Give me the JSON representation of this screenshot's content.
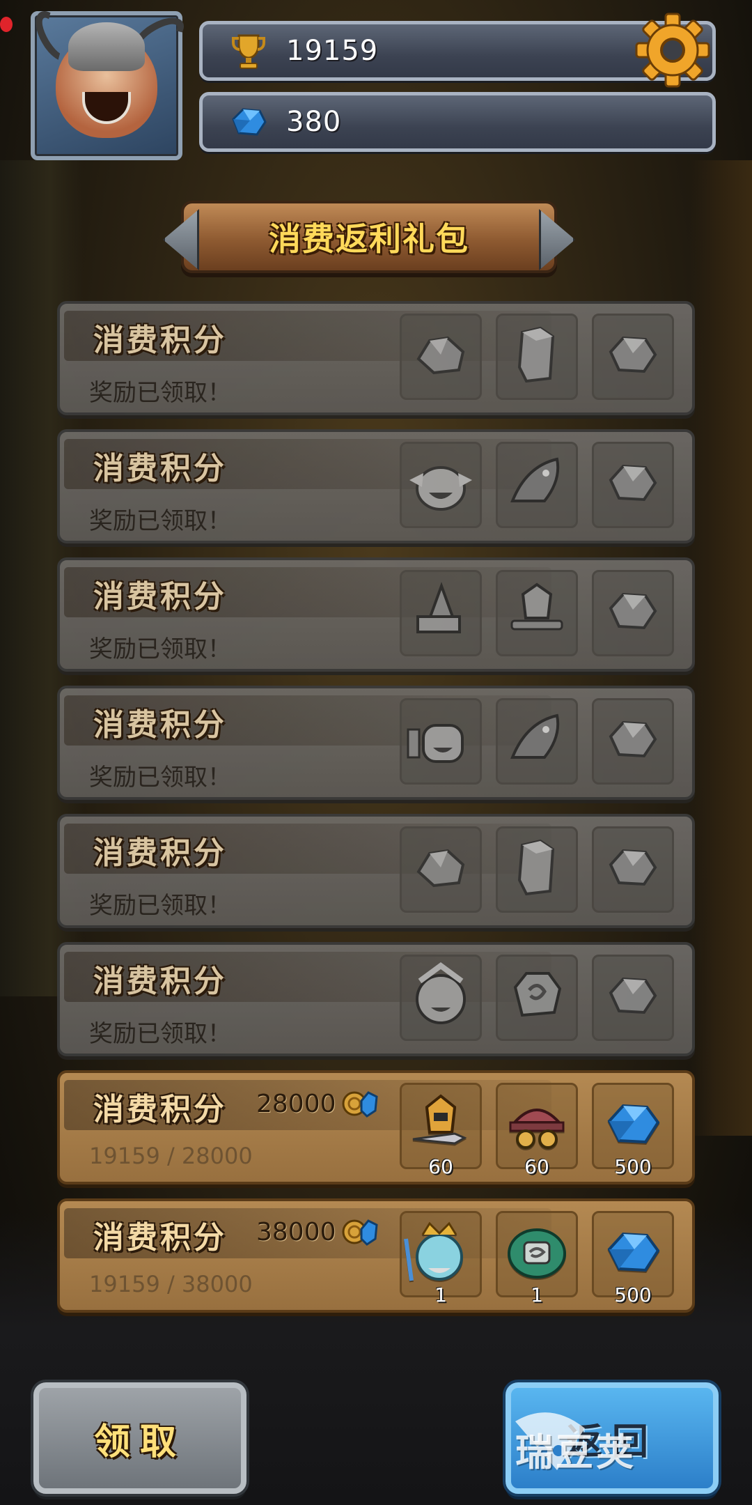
{
  "header": {
    "gold_value": "19159",
    "gem_value": "380",
    "avatar_icon": "knight-hero-avatar",
    "settings_icon": "gear-icon"
  },
  "title": "消费返利礼包",
  "rows": [
    {
      "title": "消费积分",
      "status": "奖励已领取！",
      "claimed": true,
      "rewards": [
        {
          "icon": "ore-chunk-icon"
        },
        {
          "icon": "crystal-pillar-icon"
        },
        {
          "icon": "gem-icon"
        }
      ]
    },
    {
      "title": "消费积分",
      "status": "奖励已领取！",
      "claimed": true,
      "rewards": [
        {
          "icon": "hero-pet-icon"
        },
        {
          "icon": "shark-pet-icon"
        },
        {
          "icon": "gem-icon"
        }
      ]
    },
    {
      "title": "消费积分",
      "status": "奖励已领取！",
      "claimed": true,
      "rewards": [
        {
          "icon": "wizard-hat-book-icon"
        },
        {
          "icon": "armor-set-icon"
        },
        {
          "icon": "gem-icon"
        }
      ]
    },
    {
      "title": "消费积分",
      "status": "奖励已领取！",
      "claimed": true,
      "rewards": [
        {
          "icon": "robot-pet-icon"
        },
        {
          "icon": "shark-pet-icon"
        },
        {
          "icon": "gem-icon"
        }
      ]
    },
    {
      "title": "消费积分",
      "status": "奖励已领取！",
      "claimed": true,
      "rewards": [
        {
          "icon": "ore-chunk-icon"
        },
        {
          "icon": "crystal-pillar-icon"
        },
        {
          "icon": "gem-icon"
        }
      ]
    },
    {
      "title": "消费积分",
      "status": "奖励已领取！",
      "claimed": true,
      "rewards": [
        {
          "icon": "warrior-pet-icon"
        },
        {
          "icon": "rune-stone-icon"
        },
        {
          "icon": "gem-icon"
        }
      ]
    },
    {
      "title": "消费积分",
      "target": "28000",
      "progress_text": "19159 / 28000",
      "claimed": false,
      "rewards": [
        {
          "icon": "gold-armor-icon",
          "qty": "60"
        },
        {
          "icon": "goggles-hat-icon",
          "qty": "60"
        },
        {
          "icon": "blue-gem-icon",
          "qty": "500"
        }
      ]
    },
    {
      "title": "消费积分",
      "target": "38000",
      "progress_text": "19159 / 38000",
      "claimed": false,
      "rewards": [
        {
          "icon": "poseidon-pet-icon",
          "qty": "1"
        },
        {
          "icon": "green-rune-icon",
          "qty": "1"
        },
        {
          "icon": "blue-gem-icon",
          "qty": "500"
        }
      ]
    }
  ],
  "buttons": {
    "claim": "领取",
    "back": "返回"
  },
  "watermark": "瑞豆荚",
  "colors": {
    "title_text": "#ffd95a",
    "active_row": "#b48952",
    "claimed_row": "#6f6c68",
    "back_button": "#3a94dc"
  }
}
